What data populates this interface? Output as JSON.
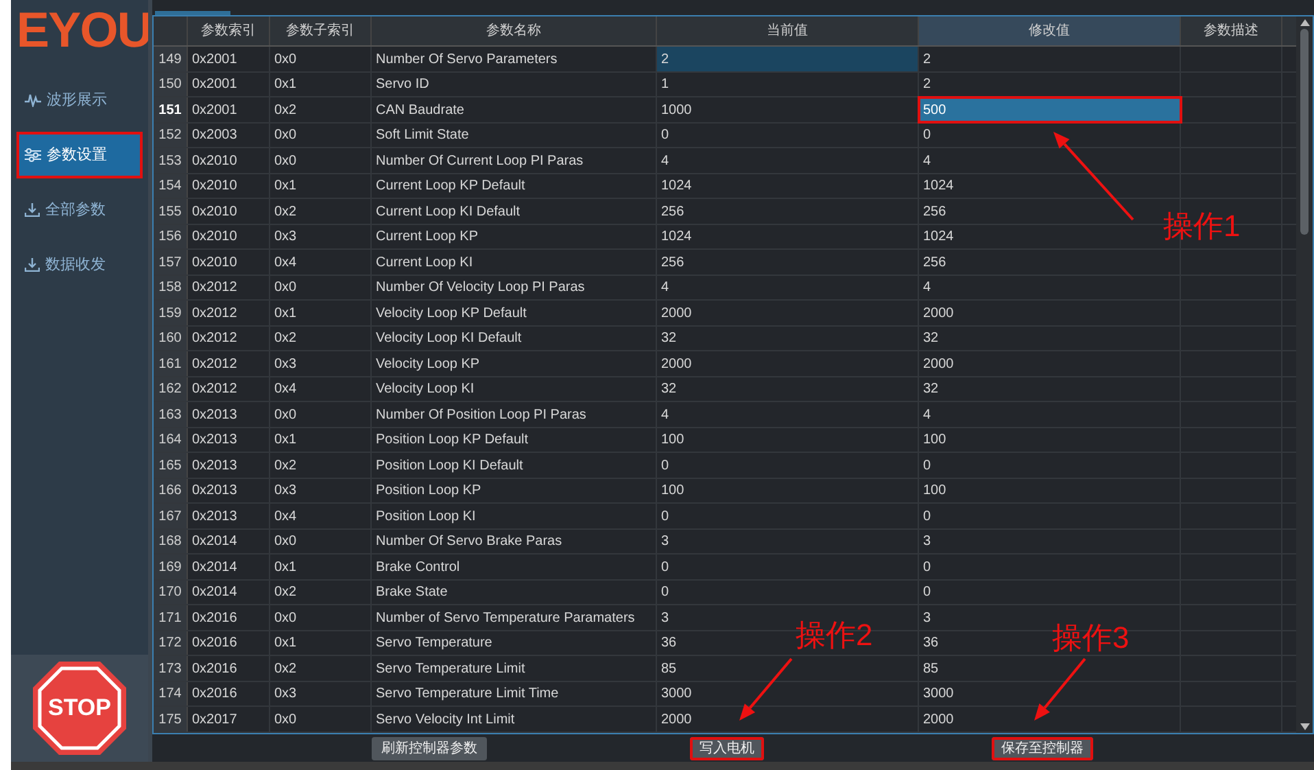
{
  "logo": "EYOU",
  "nav": [
    {
      "label": "波形展示",
      "kind": "wave",
      "selected": false,
      "annotated": false
    },
    {
      "label": "参数设置",
      "kind": "sliders",
      "selected": true,
      "annotated": true
    },
    {
      "label": "全部参数",
      "kind": "download",
      "selected": false,
      "annotated": false
    },
    {
      "label": "数据收发",
      "kind": "download",
      "selected": false,
      "annotated": false
    }
  ],
  "stop_button": "STOP",
  "table": {
    "columns": [
      "参数索引",
      "参数子索引",
      "参数名称",
      "当前值",
      "修改值",
      "参数描述"
    ],
    "rows": [
      {
        "number": "149",
        "index": "0x2001",
        "subindex": "0x0",
        "name": "Number Of Servo Parameters",
        "current": "2",
        "modified": "2",
        "selected": false,
        "current_focused": true,
        "annotated": false
      },
      {
        "number": "150",
        "index": "0x2001",
        "subindex": "0x1",
        "name": "Servo ID",
        "current": "1",
        "modified": "2",
        "selected": false,
        "current_focused": false,
        "annotated": false
      },
      {
        "number": "151",
        "index": "0x2001",
        "subindex": "0x2",
        "name": "CAN Baudrate",
        "current": "1000",
        "modified": "500",
        "selected": true,
        "current_focused": false,
        "annotated": true
      },
      {
        "number": "152",
        "index": "0x2003",
        "subindex": "0x0",
        "name": "Soft Limit State",
        "current": "0",
        "modified": "0",
        "selected": false,
        "current_focused": false,
        "annotated": false
      },
      {
        "number": "153",
        "index": "0x2010",
        "subindex": "0x0",
        "name": "Number Of Current Loop PI Paras",
        "current": "4",
        "modified": "4",
        "selected": false,
        "current_focused": false,
        "annotated": false
      },
      {
        "number": "154",
        "index": "0x2010",
        "subindex": "0x1",
        "name": "Current Loop KP Default",
        "current": "1024",
        "modified": "1024",
        "selected": false,
        "current_focused": false,
        "annotated": false
      },
      {
        "number": "155",
        "index": "0x2010",
        "subindex": "0x2",
        "name": "Current Loop KI Default",
        "current": "256",
        "modified": "256",
        "selected": false,
        "current_focused": false,
        "annotated": false
      },
      {
        "number": "156",
        "index": "0x2010",
        "subindex": "0x3",
        "name": "Current Loop KP",
        "current": "1024",
        "modified": "1024",
        "selected": false,
        "current_focused": false,
        "annotated": false
      },
      {
        "number": "157",
        "index": "0x2010",
        "subindex": "0x4",
        "name": "Current Loop KI",
        "current": "256",
        "modified": "256",
        "selected": false,
        "current_focused": false,
        "annotated": false
      },
      {
        "number": "158",
        "index": "0x2012",
        "subindex": "0x0",
        "name": "Number Of Velocity Loop PI Paras",
        "current": "4",
        "modified": "4",
        "selected": false,
        "current_focused": false,
        "annotated": false
      },
      {
        "number": "159",
        "index": "0x2012",
        "subindex": "0x1",
        "name": "Velocity Loop KP Default",
        "current": "2000",
        "modified": "2000",
        "selected": false,
        "current_focused": false,
        "annotated": false
      },
      {
        "number": "160",
        "index": "0x2012",
        "subindex": "0x2",
        "name": "Velocity Loop KI Default",
        "current": "32",
        "modified": "32",
        "selected": false,
        "current_focused": false,
        "annotated": false
      },
      {
        "number": "161",
        "index": "0x2012",
        "subindex": "0x3",
        "name": "Velocity Loop KP",
        "current": "2000",
        "modified": "2000",
        "selected": false,
        "current_focused": false,
        "annotated": false
      },
      {
        "number": "162",
        "index": "0x2012",
        "subindex": "0x4",
        "name": "Velocity Loop KI",
        "current": "32",
        "modified": "32",
        "selected": false,
        "current_focused": false,
        "annotated": false
      },
      {
        "number": "163",
        "index": "0x2013",
        "subindex": "0x0",
        "name": "Number Of Position Loop PI Paras",
        "current": "4",
        "modified": "4",
        "selected": false,
        "current_focused": false,
        "annotated": false
      },
      {
        "number": "164",
        "index": "0x2013",
        "subindex": "0x1",
        "name": "Position Loop KP Default",
        "current": "100",
        "modified": "100",
        "selected": false,
        "current_focused": false,
        "annotated": false
      },
      {
        "number": "165",
        "index": "0x2013",
        "subindex": "0x2",
        "name": "Position Loop KI Default",
        "current": "0",
        "modified": "0",
        "selected": false,
        "current_focused": false,
        "annotated": false
      },
      {
        "number": "166",
        "index": "0x2013",
        "subindex": "0x3",
        "name": "Position Loop KP",
        "current": "100",
        "modified": "100",
        "selected": false,
        "current_focused": false,
        "annotated": false
      },
      {
        "number": "167",
        "index": "0x2013",
        "subindex": "0x4",
        "name": "Position Loop KI",
        "current": "0",
        "modified": "0",
        "selected": false,
        "current_focused": false,
        "annotated": false
      },
      {
        "number": "168",
        "index": "0x2014",
        "subindex": "0x0",
        "name": "Number Of Servo Brake Paras",
        "current": "3",
        "modified": "3",
        "selected": false,
        "current_focused": false,
        "annotated": false
      },
      {
        "number": "169",
        "index": "0x2014",
        "subindex": "0x1",
        "name": "Brake Control",
        "current": "0",
        "modified": "0",
        "selected": false,
        "current_focused": false,
        "annotated": false
      },
      {
        "number": "170",
        "index": "0x2014",
        "subindex": "0x2",
        "name": "Brake State",
        "current": "0",
        "modified": "0",
        "selected": false,
        "current_focused": false,
        "annotated": false
      },
      {
        "number": "171",
        "index": "0x2016",
        "subindex": "0x0",
        "name": "Number of Servo Temperature Paramaters",
        "current": "3",
        "modified": "3",
        "selected": false,
        "current_focused": false,
        "annotated": false
      },
      {
        "number": "172",
        "index": "0x2016",
        "subindex": "0x1",
        "name": "Servo Temperature",
        "current": "36",
        "modified": "36",
        "selected": false,
        "current_focused": false,
        "annotated": false
      },
      {
        "number": "173",
        "index": "0x2016",
        "subindex": "0x2",
        "name": "Servo Temperature Limit",
        "current": "85",
        "modified": "85",
        "selected": false,
        "current_focused": false,
        "annotated": false
      },
      {
        "number": "174",
        "index": "0x2016",
        "subindex": "0x3",
        "name": "Servo Temperature Limit Time",
        "current": "3000",
        "modified": "3000",
        "selected": false,
        "current_focused": false,
        "annotated": false
      },
      {
        "number": "175",
        "index": "0x2017",
        "subindex": "0x0",
        "name": "Servo Velocity Int Limit",
        "current": "2000",
        "modified": "2000",
        "selected": false,
        "current_focused": false,
        "annotated": false
      }
    ]
  },
  "buttons": [
    {
      "label": "刷新控制器参数",
      "annotated": false
    },
    {
      "label": "写入电机",
      "annotated": true
    },
    {
      "label": "保存至控制器",
      "annotated": true
    }
  ],
  "annotations": [
    {
      "label": "操作1"
    },
    {
      "label": "操作2"
    },
    {
      "label": "操作3"
    }
  ]
}
